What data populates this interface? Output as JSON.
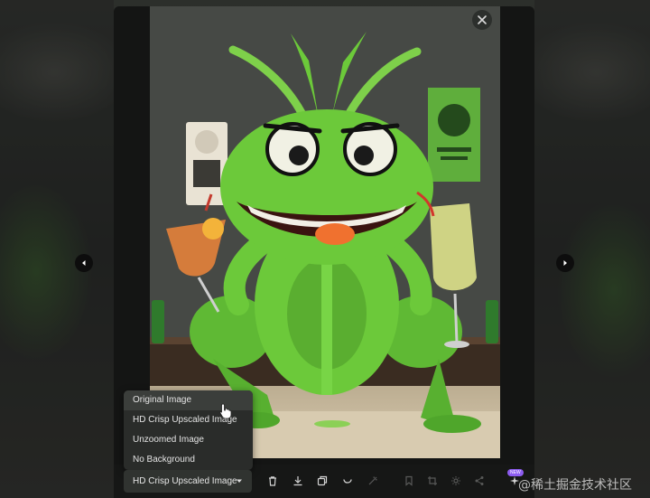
{
  "menu": {
    "items": [
      {
        "label": "Original Image"
      },
      {
        "label": "HD Crisp Upscaled Image"
      },
      {
        "label": "Unzoomed Image"
      },
      {
        "label": "No Background"
      }
    ]
  },
  "toolbar": {
    "selected_version": "HD Crisp Upscaled Image",
    "new_badge": "NEW"
  },
  "watermark": "@稀土掘金技术社区",
  "colors": {
    "frog_green": "#6cc93a",
    "panel_bg": "#141514",
    "menu_bg": "#2a2c2a",
    "accent_badge": "#8d5cf0"
  },
  "icons": {
    "close": "close-icon",
    "prev": "chevron-left-icon",
    "next": "chevron-right-icon",
    "caret": "caret-down-icon"
  }
}
